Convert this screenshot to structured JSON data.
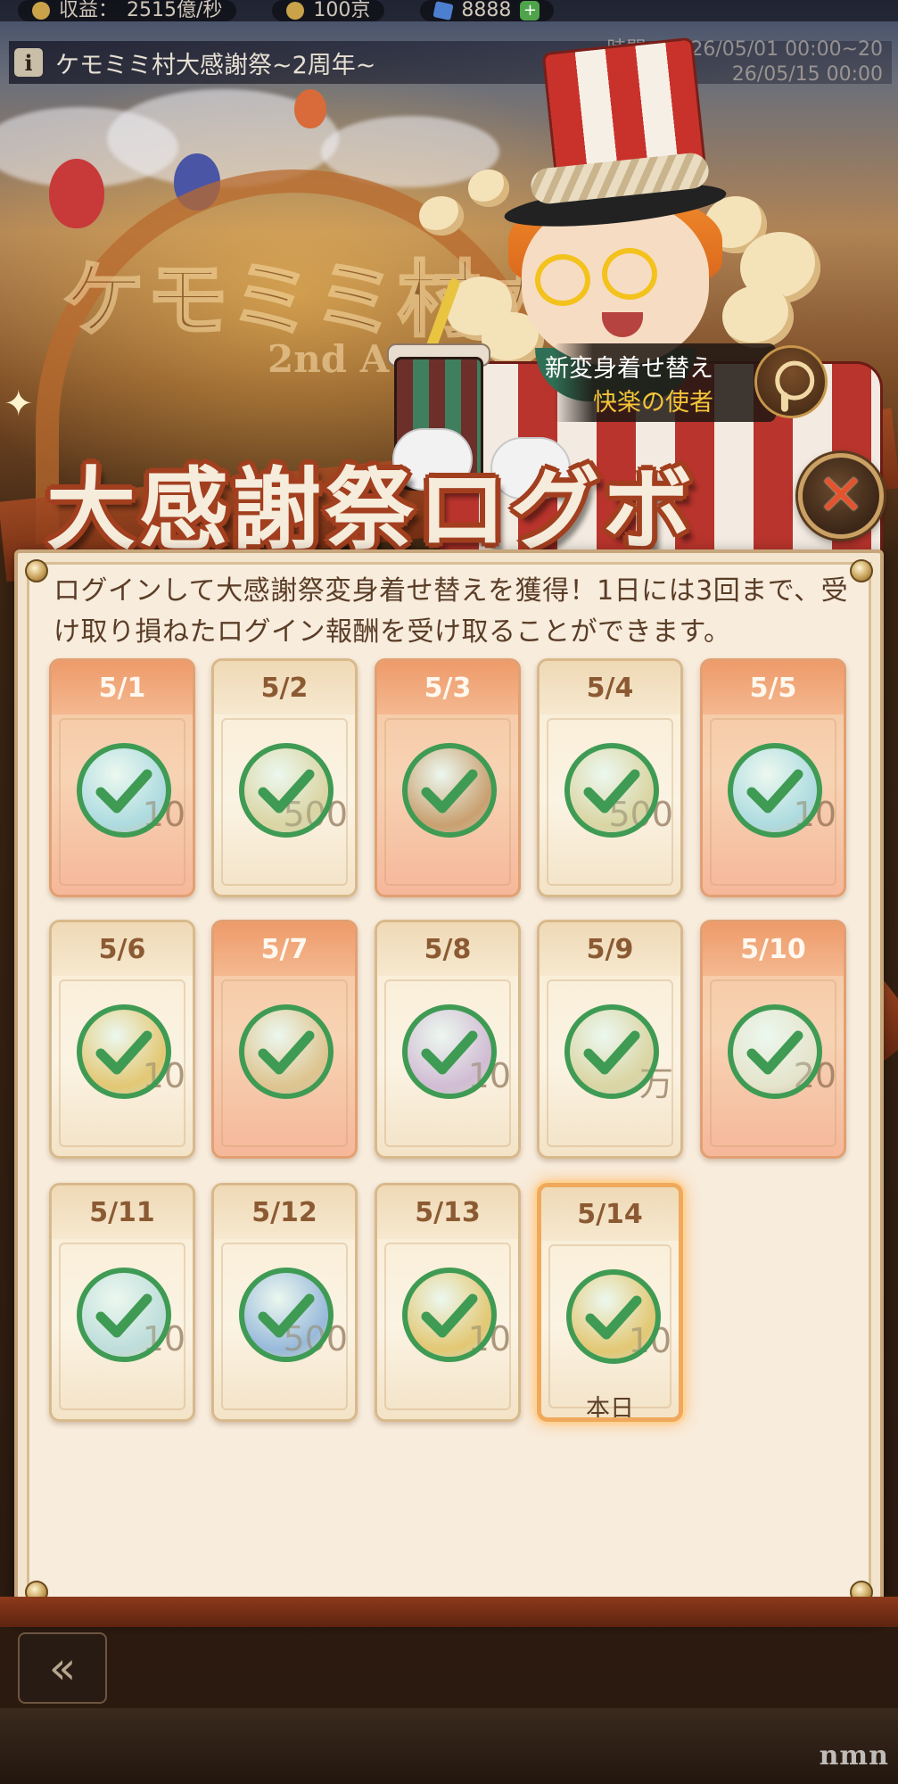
{
  "status_bar": {
    "income_label": "収益：",
    "income_value": "2515億/秒",
    "count_value": "100京",
    "gem_value": "8888",
    "plus_label": "+"
  },
  "event": {
    "info_icon": "i",
    "name": "ケモミミ村大感謝祭~2周年~",
    "time_line1": "時間：2026/05/01 00:00~20",
    "time_line2": "26/05/15 00:00"
  },
  "background": {
    "arch_title": "ケモミミ村大",
    "arch_subtitle": "2nd A"
  },
  "costume": {
    "label": "新変身着せ替え",
    "name": "快楽の使者",
    "icon": "magnifier-icon"
  },
  "title": "大感謝祭ログボ",
  "description": "ログインして大感謝祭変身着せ替えを獲得！1日には3回まで、受け取り損ねたログイン報酬を受け取ることができます。",
  "close_icon": "close-x-icon",
  "days": [
    {
      "date": "5/1",
      "style": "orange",
      "claimed": true,
      "reward_icon": "rainbow-gem-icon",
      "reward_color": "#9fd3e8",
      "qty": "10"
    },
    {
      "date": "5/2",
      "style": "plain",
      "claimed": true,
      "reward_icon": "ticket-bag-icon",
      "reward_color": "#e3c98a",
      "qty": "500"
    },
    {
      "date": "5/3",
      "style": "orange",
      "claimed": true,
      "reward_icon": "treasure-box-icon",
      "reward_color": "#c9783c",
      "qty": ""
    },
    {
      "date": "5/4",
      "style": "plain",
      "claimed": true,
      "reward_icon": "ticket-bag-icon",
      "reward_color": "#e3c98a",
      "qty": "500"
    },
    {
      "date": "5/5",
      "style": "orange",
      "claimed": true,
      "reward_icon": "rainbow-gem-icon",
      "reward_color": "#9fd3e8",
      "qty": "10"
    },
    {
      "date": "5/6",
      "style": "plain",
      "claimed": true,
      "reward_icon": "gold-coin-pouch-icon",
      "reward_color": "#f1b542",
      "qty": "10"
    },
    {
      "date": "5/7",
      "style": "orange",
      "claimed": true,
      "reward_icon": "character-portrait-icon",
      "reward_color": "#e9b06d",
      "qty": ""
    },
    {
      "date": "5/8",
      "style": "plain",
      "claimed": true,
      "reward_icon": "pink-heart-orb-icon",
      "reward_color": "#d6a3d6",
      "qty": "10"
    },
    {
      "date": "5/9",
      "style": "plain",
      "claimed": true,
      "reward_icon": "ticket-bag-icon",
      "reward_color": "#e3c98a",
      "qty": "万"
    },
    {
      "date": "5/10",
      "style": "orange",
      "claimed": true,
      "reward_icon": "gift-frame-icon",
      "reward_color": "#f4e0c8",
      "qty": "20"
    },
    {
      "date": "5/11",
      "style": "plain",
      "claimed": true,
      "reward_icon": "crystal-orb-icon",
      "reward_color": "#b9d7e0",
      "qty": "10"
    },
    {
      "date": "5/12",
      "style": "plain",
      "claimed": true,
      "reward_icon": "blue-gem-icon",
      "reward_color": "#7e9fe0",
      "qty": "500"
    },
    {
      "date": "5/13",
      "style": "plain",
      "claimed": true,
      "reward_icon": "gold-coin-pouch-icon",
      "reward_color": "#f1b542",
      "qty": "10"
    },
    {
      "date": "5/14",
      "style": "plain",
      "claimed": true,
      "reward_icon": "gold-coin-pouch-icon",
      "reward_color": "#f1b542",
      "qty": "10",
      "today": true,
      "today_label": "本日"
    }
  ],
  "back_icon": "double-chevron-left-icon",
  "watermark": "nmn"
}
